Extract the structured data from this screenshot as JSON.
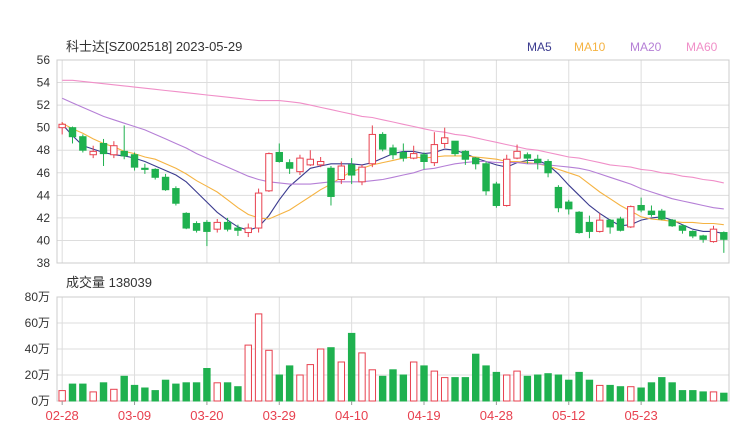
{
  "header": {
    "title": "科士达[SZ002518] 2023-05-29",
    "legend": [
      {
        "label": "MA5",
        "color": "#3b3b8f"
      },
      {
        "label": "MA10",
        "color": "#f5b342"
      },
      {
        "label": "MA20",
        "color": "#b57fd6"
      },
      {
        "label": "MA60",
        "color": "#f08fc8"
      }
    ]
  },
  "volume_header": "成交量 138039",
  "colors": {
    "up": "#e8414f",
    "down": "#1fb14f",
    "grid": "#dddddd",
    "axis_text": "#333333",
    "date_text": "#e8414f"
  },
  "chart_data": [
    {
      "type": "candlestick",
      "ylim": [
        38,
        56
      ],
      "yticks": [
        "56",
        "54",
        "52",
        "50",
        "48",
        "46",
        "44",
        "42",
        "40",
        "38"
      ],
      "xtick_labels": [
        {
          "label": "02-28",
          "index": 0
        },
        {
          "label": "03-09",
          "index": 7
        },
        {
          "label": "03-20",
          "index": 14
        },
        {
          "label": "03-29",
          "index": 21
        },
        {
          "label": "04-10",
          "index": 28
        },
        {
          "label": "04-19",
          "index": 35
        },
        {
          "label": "04-28",
          "index": 42
        },
        {
          "label": "05-12",
          "index": 49
        },
        {
          "label": "05-23",
          "index": 56
        }
      ],
      "candles": [
        [
          50.0,
          50.3,
          50.5,
          49.4
        ],
        [
          50.0,
          49.2,
          50.1,
          48.6
        ],
        [
          49.2,
          48.0,
          49.4,
          47.8
        ],
        [
          47.6,
          47.9,
          48.4,
          47.3
        ],
        [
          48.6,
          47.7,
          49.0,
          46.6
        ],
        [
          47.6,
          48.4,
          48.8,
          47.3
        ],
        [
          47.9,
          47.5,
          50.2,
          47.2
        ],
        [
          47.6,
          46.5,
          47.8,
          46.2
        ],
        [
          46.4,
          46.3,
          46.8,
          45.9
        ],
        [
          46.3,
          45.6,
          46.4,
          45.4
        ],
        [
          45.6,
          44.5,
          45.9,
          44.4
        ],
        [
          44.6,
          43.3,
          44.8,
          43.1
        ],
        [
          42.4,
          41.1,
          42.5,
          41.0
        ],
        [
          41.5,
          40.9,
          41.7,
          40.7
        ],
        [
          41.6,
          40.8,
          41.8,
          39.5
        ],
        [
          41.0,
          41.6,
          41.9,
          40.7
        ],
        [
          41.6,
          41.0,
          42.0,
          40.8
        ],
        [
          41.1,
          40.9,
          41.4,
          40.4
        ],
        [
          40.7,
          41.1,
          41.5,
          40.3
        ],
        [
          41.1,
          44.2,
          44.6,
          40.7
        ],
        [
          44.4,
          47.7,
          47.8,
          44.3
        ],
        [
          47.8,
          47.0,
          48.6,
          46.9
        ],
        [
          46.9,
          46.4,
          47.2,
          45.9
        ],
        [
          46.1,
          47.3,
          47.6,
          45.8
        ],
        [
          46.7,
          47.2,
          48.0,
          46.6
        ],
        [
          46.7,
          47.0,
          47.4,
          46.5
        ],
        [
          46.4,
          43.9,
          46.6,
          43.1
        ],
        [
          45.4,
          46.6,
          47.0,
          45.0
        ],
        [
          46.7,
          45.8,
          47.3,
          45.0
        ],
        [
          45.2,
          46.5,
          46.7,
          44.9
        ],
        [
          46.8,
          49.4,
          50.2,
          46.5
        ],
        [
          49.4,
          48.1,
          49.6,
          47.9
        ],
        [
          48.2,
          47.6,
          48.5,
          47.2
        ],
        [
          47.8,
          47.3,
          48.6,
          47.0
        ],
        [
          47.3,
          47.7,
          48.4,
          47.2
        ],
        [
          47.6,
          47.0,
          47.8,
          46.3
        ],
        [
          46.9,
          48.5,
          49.6,
          46.6
        ],
        [
          48.6,
          49.1,
          50.0,
          48.2
        ],
        [
          48.8,
          47.7,
          48.8,
          47.5
        ],
        [
          47.9,
          47.2,
          48.0,
          46.7
        ],
        [
          47.3,
          46.8,
          47.4,
          46.3
        ],
        [
          46.8,
          44.4,
          47.0,
          44.0
        ],
        [
          45.0,
          43.1,
          45.2,
          42.9
        ],
        [
          43.1,
          47.2,
          47.6,
          43.0
        ],
        [
          47.3,
          47.9,
          48.5,
          47.2
        ],
        [
          47.6,
          47.3,
          47.8,
          46.8
        ],
        [
          47.2,
          46.9,
          47.6,
          46.3
        ],
        [
          47.0,
          46.0,
          47.2,
          45.6
        ],
        [
          44.7,
          42.9,
          44.9,
          42.5
        ],
        [
          43.4,
          42.8,
          43.6,
          42.3
        ],
        [
          42.5,
          40.7,
          42.6,
          40.6
        ],
        [
          41.6,
          40.8,
          42.2,
          40.2
        ],
        [
          40.8,
          41.8,
          42.4,
          40.7
        ],
        [
          41.8,
          41.2,
          41.9,
          40.6
        ],
        [
          41.9,
          40.9,
          42.1,
          40.8
        ],
        [
          41.2,
          43.0,
          43.1,
          41.1
        ],
        [
          43.1,
          42.7,
          43.8,
          42.5
        ],
        [
          42.6,
          42.3,
          43.1,
          42.1
        ],
        [
          42.6,
          41.9,
          42.8,
          41.8
        ],
        [
          41.8,
          41.3,
          41.9,
          41.2
        ],
        [
          41.3,
          40.9,
          41.4,
          40.6
        ],
        [
          40.8,
          40.4,
          40.9,
          40.2
        ],
        [
          40.4,
          40.1,
          40.5,
          39.8
        ],
        [
          39.9,
          41.0,
          41.3,
          39.8
        ],
        [
          40.7,
          40.1,
          40.8,
          38.9
        ]
      ],
      "ma": {
        "MA5": [
          50.3,
          49.3,
          48.4,
          48.1,
          47.8,
          47.6,
          47.5,
          47.3,
          47.0,
          46.6,
          46.2,
          45.8,
          45.2,
          44.3,
          43.4,
          42.5,
          41.8,
          41.2,
          40.9,
          41.2,
          42.2,
          43.6,
          44.8,
          45.6,
          46.4,
          46.6,
          46.8,
          46.8,
          46.8,
          46.7,
          46.9,
          47.3,
          47.7,
          47.9,
          47.9,
          47.7,
          47.8,
          48.1,
          48.0,
          47.7,
          47.3,
          47.0,
          46.7,
          46.5,
          46.9,
          47.1,
          47.1,
          46.7,
          45.9,
          44.9,
          44.0,
          43.1,
          42.4,
          41.8,
          41.3,
          41.4,
          41.8,
          42.0,
          42.1,
          41.8,
          41.4,
          41.0,
          40.8,
          40.8,
          40.6
        ],
        "MA10": [
          50.4,
          49.9,
          49.5,
          49.0,
          48.6,
          48.3,
          47.9,
          47.7,
          47.4,
          47.2,
          46.8,
          46.4,
          45.9,
          45.3,
          44.8,
          44.3,
          43.6,
          42.9,
          42.3,
          42.0,
          41.9,
          42.3,
          42.7,
          43.3,
          43.9,
          44.5,
          45.0,
          45.6,
          46.1,
          46.4,
          46.7,
          46.9,
          47.1,
          47.3,
          47.4,
          47.3,
          47.4,
          47.5,
          47.5,
          47.5,
          47.4,
          47.3,
          47.2,
          47.0,
          47.0,
          46.9,
          46.8,
          46.6,
          46.3,
          46.0,
          45.7,
          45.0,
          44.3,
          43.7,
          43.1,
          42.6,
          42.1,
          41.9,
          41.8,
          41.7,
          41.6,
          41.6,
          41.5,
          41.5,
          41.4
        ],
        "MA20": [
          52.6,
          52.2,
          51.8,
          51.4,
          51.0,
          50.7,
          50.4,
          50.1,
          49.8,
          49.4,
          49.0,
          48.6,
          48.2,
          47.7,
          47.3,
          46.9,
          46.5,
          46.1,
          45.7,
          45.4,
          45.2,
          45.1,
          45.0,
          45.0,
          45.0,
          45.1,
          45.2,
          45.2,
          45.2,
          45.2,
          45.3,
          45.4,
          45.6,
          45.8,
          46.0,
          46.3,
          46.4,
          46.6,
          46.8,
          46.9,
          47.0,
          47.0,
          46.9,
          46.9,
          46.9,
          46.8,
          46.8,
          46.7,
          46.6,
          46.5,
          46.4,
          46.2,
          45.9,
          45.6,
          45.3,
          45.0,
          44.6,
          44.3,
          44.0,
          43.7,
          43.5,
          43.3,
          43.1,
          42.9,
          42.8
        ],
        "MA60": [
          54.2,
          54.2,
          54.1,
          54.0,
          53.9,
          53.8,
          53.7,
          53.6,
          53.5,
          53.4,
          53.3,
          53.2,
          53.1,
          53.0,
          52.9,
          52.8,
          52.7,
          52.6,
          52.5,
          52.4,
          52.4,
          52.4,
          52.3,
          52.2,
          52.0,
          51.8,
          51.6,
          51.4,
          51.2,
          51.0,
          50.9,
          50.7,
          50.5,
          50.3,
          50.1,
          49.9,
          49.7,
          49.6,
          49.4,
          49.3,
          49.1,
          48.9,
          48.7,
          48.5,
          48.3,
          48.1,
          48.0,
          47.8,
          47.6,
          47.4,
          47.3,
          47.1,
          46.9,
          46.7,
          46.6,
          46.5,
          46.3,
          46.2,
          46.0,
          45.9,
          45.7,
          45.6,
          45.4,
          45.3,
          45.1
        ]
      }
    },
    {
      "type": "bar",
      "title": "成交量",
      "ylim": [
        0,
        80
      ],
      "unit": "万",
      "yticks": [
        "80万",
        "60万",
        "40万",
        "20万",
        "0万"
      ],
      "values": [
        8,
        13,
        13,
        7,
        14,
        9,
        19,
        12,
        10,
        8,
        16,
        13,
        14,
        14,
        25,
        14,
        14,
        11,
        43,
        67,
        39,
        20,
        27,
        20,
        28,
        40,
        41,
        30,
        52,
        37,
        24,
        19,
        24,
        20,
        30,
        27,
        23,
        18,
        18,
        18,
        36,
        27,
        22,
        20,
        23,
        19,
        20,
        21,
        20,
        16,
        22,
        16,
        12,
        12,
        11,
        11,
        10,
        14,
        18,
        14,
        8,
        8,
        7,
        7,
        6
      ]
    }
  ]
}
